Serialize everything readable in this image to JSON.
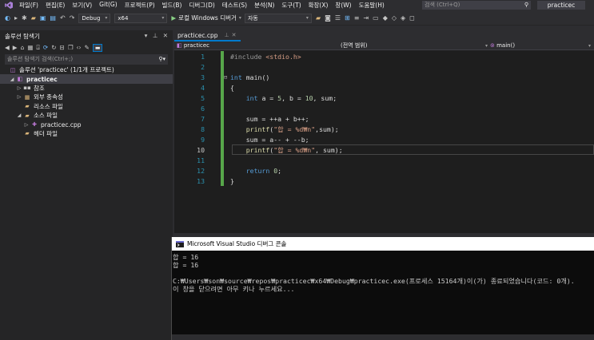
{
  "menubar": {
    "items": [
      "파일(F)",
      "편집(E)",
      "보기(V)",
      "Git(G)",
      "프로젝트(P)",
      "빌드(B)",
      "디버그(D)",
      "테스트(S)",
      "분석(N)",
      "도구(T)",
      "확장(X)",
      "창(W)",
      "도움말(H)"
    ],
    "search_placeholder": "검색 (Ctrl+Q)",
    "project_name": "practicec"
  },
  "toolbar": {
    "configuration": "Debug",
    "platform": "x64",
    "run_label": "로컬 Windows 디버거",
    "auto_label": "자동"
  },
  "solution_explorer": {
    "title": "솔루션 탐색기",
    "search_placeholder": "솔루션 탐색기 검색(Ctrl+;)",
    "tree": [
      {
        "label": "솔루션 'practicec' (1/1개 프로젝트)",
        "icon": "solution-icon",
        "indent": 0
      },
      {
        "label": "practicec",
        "icon": "project-icon",
        "indent": 1,
        "selected": true,
        "bold": true
      },
      {
        "label": "참조",
        "icon": "references-icon",
        "indent": 2
      },
      {
        "label": "외부 종속성",
        "icon": "external-deps-icon",
        "indent": 2
      },
      {
        "label": "리소스 파일",
        "icon": "folder-icon",
        "indent": 2
      },
      {
        "label": "소스 파일",
        "icon": "folder-icon",
        "indent": 2
      },
      {
        "label": "practicec.cpp",
        "icon": "cpp-file-icon",
        "indent": 3
      },
      {
        "label": "헤더 파일",
        "icon": "folder-icon",
        "indent": 2
      }
    ]
  },
  "editor": {
    "tab_label": "practicec.cpp",
    "nav_project": "practicec",
    "nav_scope": "(전역 범위)",
    "nav_function": "main()",
    "lines": [
      {
        "n": "1",
        "fold": "",
        "text": "#include <stdio.h>"
      },
      {
        "n": "2",
        "fold": "",
        "text": ""
      },
      {
        "n": "3",
        "fold": "⊟",
        "text": "int main()"
      },
      {
        "n": "4",
        "fold": "",
        "text": "{"
      },
      {
        "n": "5",
        "fold": "",
        "text": "    int a = 5, b = 10, sum;"
      },
      {
        "n": "6",
        "fold": "",
        "text": ""
      },
      {
        "n": "7",
        "fold": "",
        "text": "    sum = ++a + b++;"
      },
      {
        "n": "8",
        "fold": "",
        "text": "    printf(\"합 = %d₩n\",sum);"
      },
      {
        "n": "9",
        "fold": "",
        "text": "    sum = a-- + --b;"
      },
      {
        "n": "10",
        "fold": "",
        "text": "    printf(\"합 = %d₩n\", sum);"
      },
      {
        "n": "11",
        "fold": "",
        "text": ""
      },
      {
        "n": "12",
        "fold": "",
        "text": "    return 0;"
      },
      {
        "n": "13",
        "fold": "",
        "text": "}"
      }
    ],
    "current_line": 10
  },
  "console": {
    "title": "Microsoft Visual Studio 디버그 콘솔",
    "output_lines": [
      "합 = 16",
      "합 = 16",
      "",
      "C:₩Users₩son₩source₩repos₩practicec₩x64₩Debug₩practicec.exe(프로세스 15164개)이(가) 종료되었습니다(코드: 0개).",
      "이 창을 닫으려면 아무 키나 누르세요..."
    ]
  },
  "colors": {
    "accent": "#007acc",
    "change_bar": "#57a64a",
    "keyword": "#569cd6",
    "string": "#d69d85",
    "number": "#b5cea8",
    "preprocessor": "#9b9b9b",
    "line_number": "#2b91af"
  }
}
